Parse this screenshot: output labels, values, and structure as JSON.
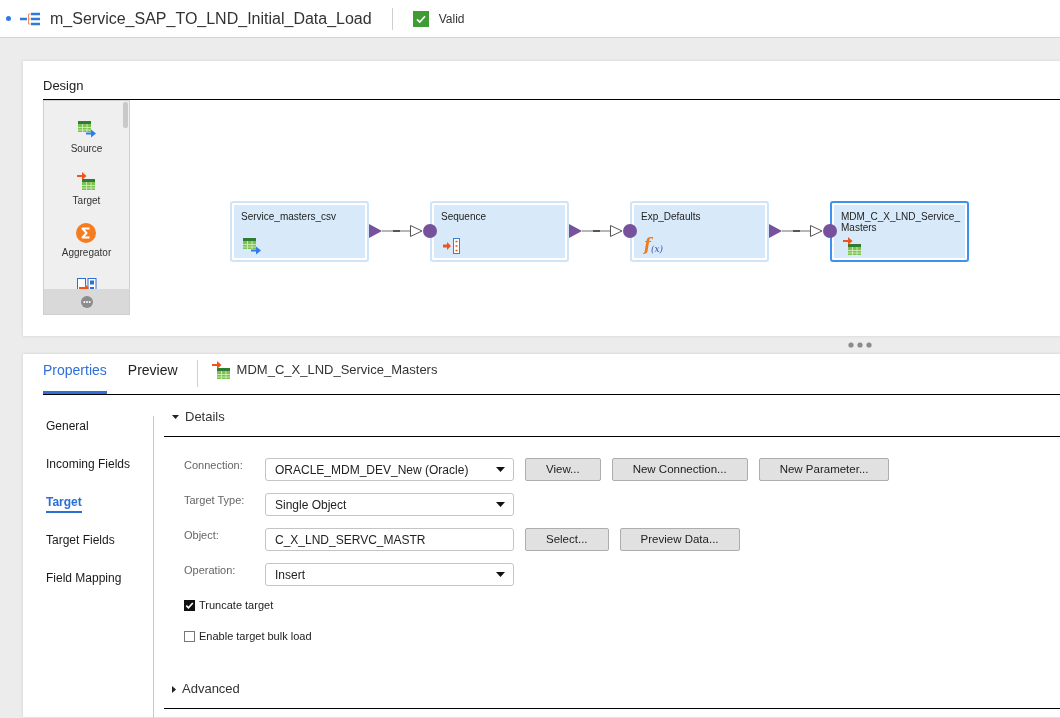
{
  "header": {
    "title": "m_Service_SAP_TO_LND_Initial_Data_Load",
    "status": {
      "label": "Valid",
      "valid": true
    }
  },
  "design": {
    "title": "Design",
    "palette": [
      {
        "kind": "source",
        "label": "Source"
      },
      {
        "kind": "target",
        "label": "Target"
      },
      {
        "kind": "aggregator",
        "label": "Aggregator"
      },
      {
        "kind": "other"
      }
    ],
    "nodes": [
      {
        "kind": "source",
        "label": "Service_masters_csv",
        "selected": false
      },
      {
        "kind": "sequence",
        "label": "Sequence",
        "selected": false
      },
      {
        "kind": "expression",
        "label": "Exp_Defaults",
        "selected": false,
        "icon_text": "f$_{(x)}$"
      },
      {
        "kind": "target",
        "label": "MDM_C_X_LND_Service_Masters",
        "selected": true
      }
    ]
  },
  "properties": {
    "tabs": [
      {
        "label": "Properties",
        "selected": true
      },
      {
        "label": "Preview",
        "selected": false
      }
    ],
    "object": {
      "kind": "target",
      "label": "MDM_C_X_LND_Service_Masters"
    },
    "nav": [
      {
        "label": "General",
        "selected": false
      },
      {
        "label": "Incoming Fields",
        "selected": false
      },
      {
        "label": "Target",
        "selected": true
      },
      {
        "label": "Target Fields",
        "selected": false
      },
      {
        "label": "Field Mapping",
        "selected": false
      }
    ],
    "sections": [
      {
        "title": "Details",
        "expanded": true,
        "fields": [
          {
            "label": "Connection:",
            "kind": "dropdown",
            "value": "ORACLE_MDM_DEV_New (Oracle)",
            "buttons": [
              "View...",
              "New Connection...",
              "New Parameter..."
            ]
          },
          {
            "label": "Target Type:",
            "kind": "dropdown",
            "value": "Single Object"
          },
          {
            "label": "Object:",
            "kind": "text",
            "value": "C_X_LND_SERVC_MASTR",
            "buttons": [
              "Select...",
              "Preview Data..."
            ]
          },
          {
            "label": "Operation:",
            "kind": "dropdown",
            "value": "Insert"
          }
        ],
        "checkboxes": [
          {
            "label": "Truncate target",
            "checked": true
          },
          {
            "label": "Enable target bulk load",
            "checked": false
          }
        ]
      },
      {
        "title": "Advanced",
        "expanded": false
      }
    ]
  }
}
